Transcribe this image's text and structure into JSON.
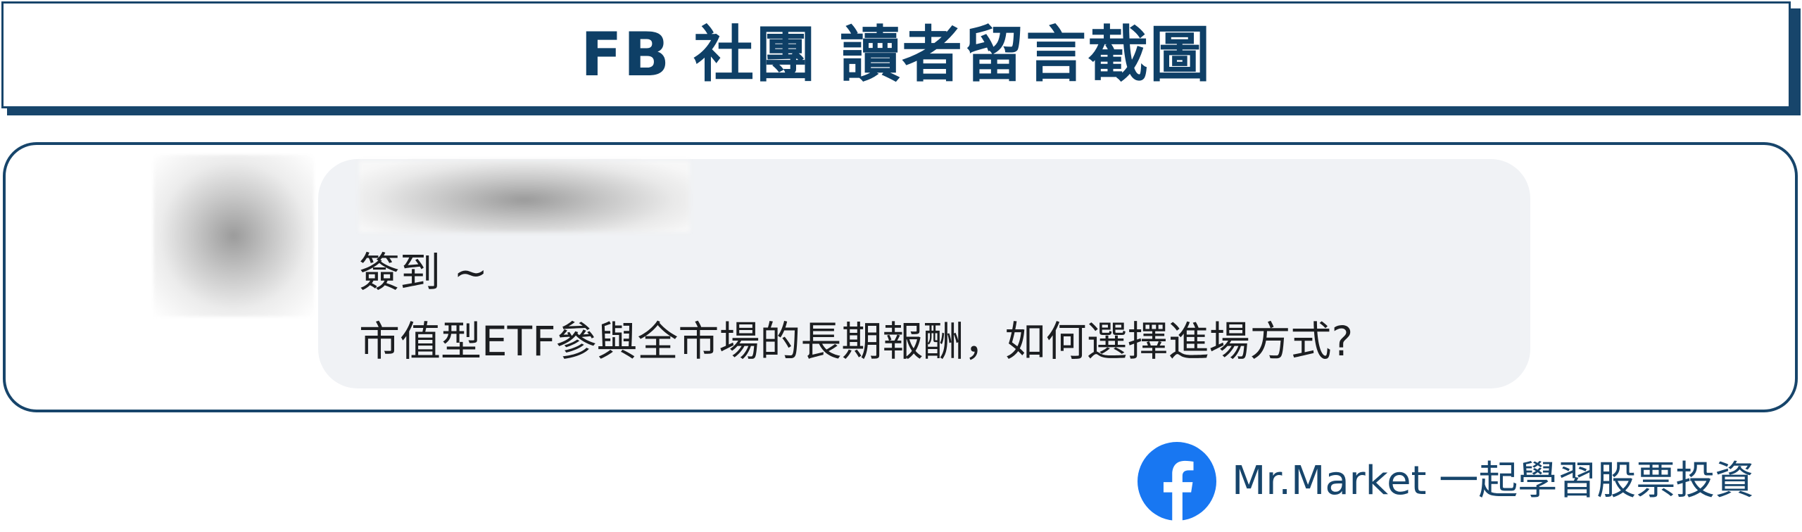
{
  "header": {
    "title": "FB 社團 讀者留言截圖"
  },
  "comment": {
    "line_1": "簽到 ~",
    "line_2": "市值型ETF參與全市場的長期報酬，如何選擇進場方式?"
  },
  "footer": {
    "brand_text": "Mr.Market  一起學習股票投資",
    "icon": "facebook-icon"
  },
  "colors": {
    "accent": "#17456b",
    "title": "#0e3f66",
    "bubble": "#f0f2f5",
    "facebook_blue": "#1877f2"
  }
}
